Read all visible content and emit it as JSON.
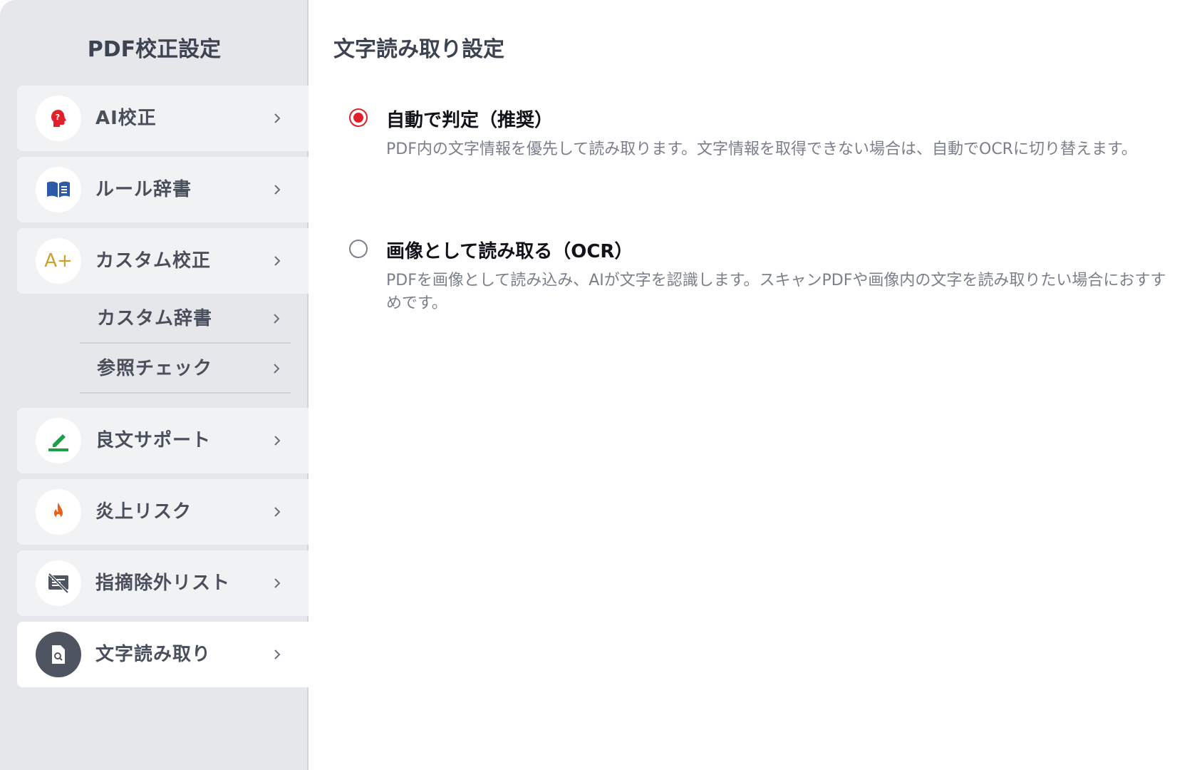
{
  "sidebar": {
    "title": "PDF校正設定",
    "items": [
      {
        "label": "AI校正",
        "icon": "ai-head-icon"
      },
      {
        "label": "ルール辞書",
        "icon": "book-icon"
      },
      {
        "label": "カスタム校正",
        "icon": "a-plus-icon",
        "icon_text": "A+"
      },
      {
        "label": "良文サポート",
        "icon": "pen-icon"
      },
      {
        "label": "炎上リスク",
        "icon": "flame-icon"
      },
      {
        "label": "指摘除外リスト",
        "icon": "excluded-list-icon"
      },
      {
        "label": "文字読み取り",
        "icon": "document-search-icon",
        "active": true
      }
    ],
    "sub_items": [
      {
        "label": "カスタム辞書"
      },
      {
        "label": "参照チェック"
      }
    ]
  },
  "main": {
    "title": "文字読み取り設定",
    "options": [
      {
        "label": "自動で判定（推奨）",
        "description": "PDF内の文字情報を優先して読み取ります。文字情報を取得できない場合は、自動でOCRに切り替えます。",
        "checked": true
      },
      {
        "label": "画像として読み取る（OCR）",
        "description": "PDFを画像として読み込み、AIが文字を認識します。スキャンPDFや画像内の文字を読み取りたい場合におすすめです。",
        "checked": false
      }
    ]
  },
  "colors": {
    "accent_red": "#e0202a",
    "sidebar_bg": "#e6e7ea",
    "book_blue": "#2b5aa8",
    "pen_green": "#1f9e4a",
    "flame_orange": "#e8611a",
    "aplus_gold": "#c9a227"
  }
}
